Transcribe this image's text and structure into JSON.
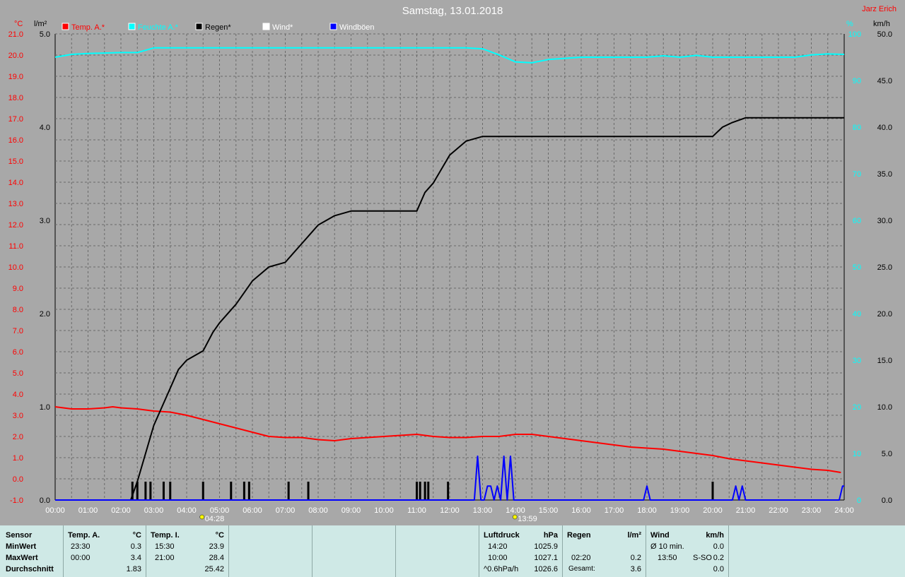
{
  "header": {
    "title": "Samstag, 13.01.2018",
    "author": "Jarz Erich"
  },
  "legend": [
    {
      "label": "Temp. A.*",
      "color": "#ff0000"
    },
    {
      "label": "Feuchte A.*",
      "color": "#00ffff"
    },
    {
      "label": "Regen*",
      "color": "#000000"
    },
    {
      "label": "Wind*",
      "color": "#ffffff"
    },
    {
      "label": "Windböen",
      "color": "#0000ff"
    }
  ],
  "units": {
    "temp": "°C",
    "rain": "l/m²",
    "humidity": "%",
    "wind": "km/h"
  },
  "chart_data": {
    "type": "line",
    "grid": true,
    "x_labels": [
      "00:00",
      "01:00",
      "02:00",
      "03:00",
      "04:00",
      "05:00",
      "06:00",
      "07:00",
      "08:00",
      "09:00",
      "10:00",
      "11:00",
      "12:00",
      "13:00",
      "14:00",
      "15:00",
      "16:00",
      "17:00",
      "18:00",
      "19:00",
      "20:00",
      "21:00",
      "22:00",
      "23:00",
      "24:00"
    ],
    "axes": {
      "temp": {
        "min": -1,
        "max": 21,
        "step": 1,
        "color": "#ff0000"
      },
      "rain": {
        "min": 0,
        "max": 5,
        "ticks": [
          "0.0",
          "1.0",
          "2.0",
          "3.0",
          "4.0",
          "5.0"
        ],
        "color": "#000000"
      },
      "humidity": {
        "min": 0,
        "max": 100,
        "ticks": [
          "0",
          "10",
          "20",
          "30",
          "40",
          "50",
          "60",
          "70",
          "80",
          "90",
          "100"
        ],
        "color": "#00ffff"
      },
      "wind": {
        "min": 0,
        "max": 50,
        "ticks": [
          "0.0",
          "5.0",
          "10.0",
          "15.0",
          "20.0",
          "25.0",
          "30.0",
          "35.0",
          "40.0",
          "45.0",
          "50.0"
        ],
        "color": "#000000"
      }
    },
    "sun_markers": [
      "04:28",
      "13:59"
    ],
    "series": [
      {
        "name": "Temp. A.",
        "axis": "temp",
        "color": "#ff0000",
        "x": [
          0,
          0.5,
          1,
          1.5,
          1.75,
          2,
          2.5,
          3,
          3.5,
          4,
          4.5,
          5,
          5.5,
          6,
          6.5,
          7,
          7.5,
          8,
          8.5,
          9,
          9.5,
          10,
          10.5,
          11,
          11.5,
          12,
          12.5,
          13,
          13.5,
          14,
          14.5,
          15,
          15.5,
          16,
          16.5,
          17,
          17.5,
          18,
          18.5,
          19,
          19.5,
          20,
          20.5,
          21,
          21.5,
          22,
          22.5,
          23,
          23.5,
          23.9
        ],
        "y": [
          3.4,
          3.3,
          3.3,
          3.35,
          3.4,
          3.35,
          3.3,
          3.2,
          3.15,
          3.0,
          2.8,
          2.6,
          2.4,
          2.2,
          2.0,
          1.95,
          1.95,
          1.85,
          1.8,
          1.9,
          1.95,
          2.0,
          2.05,
          2.1,
          2.0,
          1.95,
          1.95,
          2.0,
          2.0,
          2.1,
          2.1,
          2.0,
          1.9,
          1.8,
          1.7,
          1.6,
          1.5,
          1.45,
          1.4,
          1.3,
          1.2,
          1.1,
          0.95,
          0.85,
          0.75,
          0.65,
          0.55,
          0.45,
          0.4,
          0.3
        ]
      },
      {
        "name": "Feuchte A.",
        "axis": "humidity",
        "color": "#00ffff",
        "x": [
          0,
          0.5,
          1,
          1.5,
          2,
          2.5,
          3,
          4,
          5,
          6,
          7,
          8,
          9,
          10,
          11,
          12,
          12.5,
          13,
          13.5,
          14,
          14.5,
          15,
          16,
          17,
          18,
          18.5,
          19,
          19.5,
          20,
          21,
          22,
          22.5,
          23,
          23.5,
          24
        ],
        "y": [
          95,
          95.6,
          95.8,
          95.9,
          96,
          96,
          97,
          97,
          97,
          97,
          97,
          97,
          97,
          97,
          97,
          97,
          97,
          96.8,
          95.5,
          94,
          93.8,
          94.5,
          95,
          95,
          95,
          95.3,
          95,
          95.4,
          95,
          95,
          95,
          95,
          95.5,
          95.7,
          95.6
        ]
      },
      {
        "name": "Regen",
        "axis": "rain",
        "color": "#000000",
        "x": [
          0,
          2.3,
          2.5,
          2.75,
          3,
          3.5,
          3.75,
          4.0,
          4.5,
          4.8,
          5.0,
          5.5,
          6.0,
          6.5,
          7.0,
          7.25,
          7.5,
          7.75,
          8.0,
          8.5,
          9.0,
          10.0,
          10.5,
          10.9,
          11.0,
          11.25,
          11.5,
          12.0,
          12.5,
          13.0,
          14.0,
          15.0,
          16.0,
          17.0,
          18.0,
          19.0,
          19.9,
          20.0,
          20.3,
          20.6,
          21.0,
          22.0,
          23.0,
          24.0
        ],
        "y": [
          0,
          0,
          0.2,
          0.5,
          0.8,
          1.2,
          1.4,
          1.5,
          1.6,
          1.8,
          1.9,
          2.1,
          2.35,
          2.5,
          2.55,
          2.65,
          2.75,
          2.85,
          2.95,
          3.05,
          3.1,
          3.1,
          3.1,
          3.1,
          3.1,
          3.3,
          3.4,
          3.7,
          3.85,
          3.9,
          3.9,
          3.9,
          3.9,
          3.9,
          3.9,
          3.9,
          3.9,
          3.9,
          4.0,
          4.05,
          4.1,
          4.1,
          4.1,
          4.1
        ]
      },
      {
        "name": "Windböen",
        "axis": "wind",
        "color": "#0000ff",
        "x": [
          0,
          12.75,
          12.85,
          12.95,
          13.05,
          13.15,
          13.25,
          13.35,
          13.45,
          13.55,
          13.65,
          13.75,
          13.85,
          13.95,
          14.05,
          14.1,
          17.9,
          18.0,
          18.1,
          20.6,
          20.7,
          20.8,
          20.9,
          21.0,
          23.85,
          23.95,
          24
        ],
        "y": [
          0,
          0,
          4.7,
          0,
          0,
          1.5,
          1.5,
          0,
          1.5,
          0,
          4.7,
          0,
          4.7,
          0,
          0,
          0,
          0,
          1.5,
          0,
          0,
          1.5,
          0,
          1.5,
          0,
          0,
          1.5,
          1.5
        ]
      }
    ],
    "rain_events": [
      2.35,
      2.5,
      2.75,
      2.9,
      3.3,
      3.5,
      4.5,
      5.35,
      5.75,
      5.9,
      7.1,
      7.7,
      11.0,
      11.1,
      11.25,
      11.35,
      11.95,
      20.0
    ]
  },
  "stats": {
    "rows": [
      "Sensor",
      "MinWert",
      "MaxWert",
      "Durchschnitt"
    ],
    "temp_a": {
      "header": "Temp. A.",
      "unit": "°C",
      "min_time": "23:30",
      "min": "0.3",
      "max_time": "00:00",
      "max": "3.4",
      "avg": "1.83"
    },
    "temp_i": {
      "header": "Temp. I.",
      "unit": "°C",
      "min_time": "15:30",
      "min": "23.9",
      "max_time": "21:00",
      "max": "28.4",
      "avg": "25.42"
    },
    "pressure": {
      "header": "Luftdruck",
      "unit": "hPa",
      "min_time": "14:20",
      "min": "1025.9",
      "max_time": "10:00",
      "max": "1027.1",
      "trend_label": "^0.6hPa/h",
      "avg": "1026.6"
    },
    "rain": {
      "header": "Regen",
      "unit": "l/m²",
      "max_time": "02:20",
      "max": "0.2",
      "total_label": "Gesamt:",
      "total": "3.6"
    },
    "wind": {
      "header": "Wind",
      "unit": "km/h",
      "avg_label": "Ø 10 min.",
      "avg": "0.0",
      "max_time": "13:50",
      "max_dir": "S-SO",
      "max": "0.2",
      "last": "0.0"
    }
  }
}
